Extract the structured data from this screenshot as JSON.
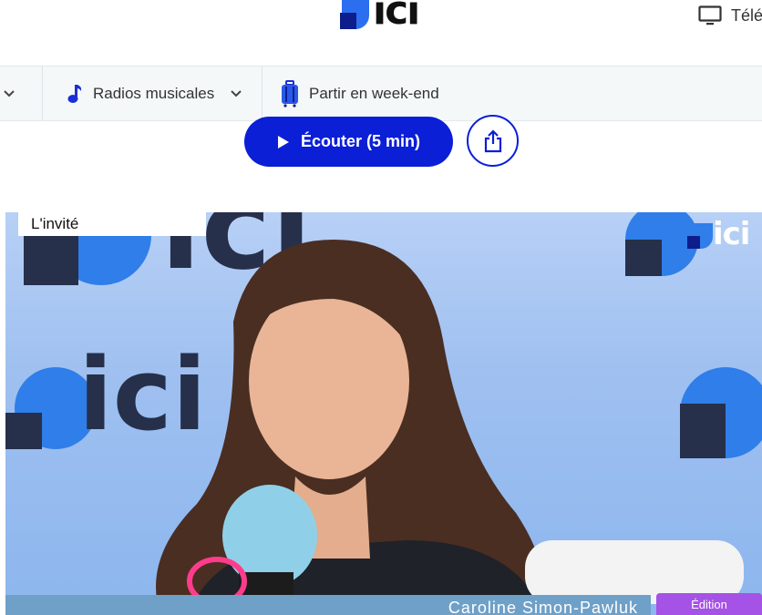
{
  "header": {
    "logo_text": "ici",
    "tv_label": "Télé"
  },
  "nav": {
    "items": [
      {
        "label": "Radios musicales",
        "icon": "music-note-icon"
      },
      {
        "label": "Partir en week-end",
        "icon": "suitcase-icon"
      }
    ]
  },
  "actions": {
    "listen_label": "Écouter (5 min)"
  },
  "video": {
    "badge": "L'invité",
    "corner_logo_text": "ici",
    "bg_logo_text": "ici",
    "guest_name": "Caroline Simon-Pawluk",
    "edition_label": "Édition"
  },
  "colors": {
    "brand_blue": "#0a1fd6",
    "logo_blue": "#2b6ff0",
    "edition_purple": "#a552e6"
  }
}
